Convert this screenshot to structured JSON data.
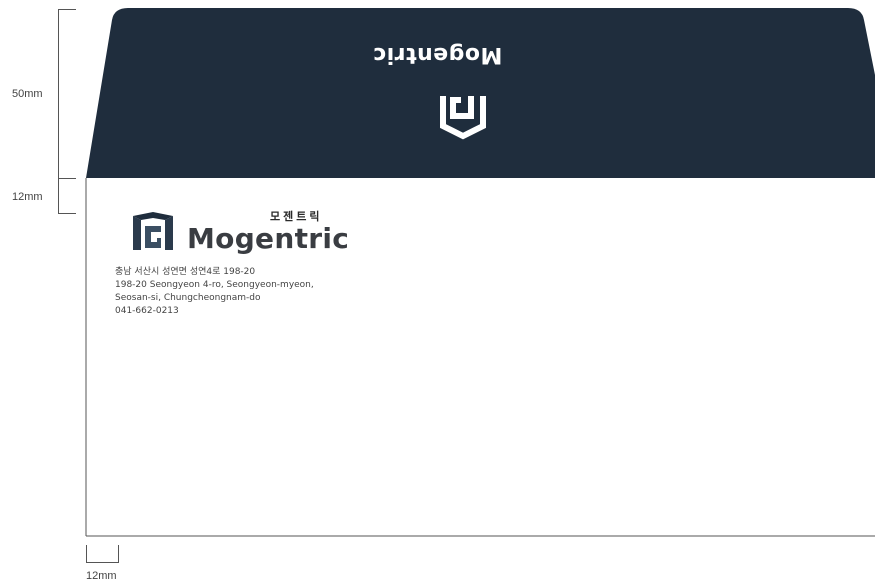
{
  "dimensions": {
    "flap_height": "50mm",
    "top_margin": "12mm",
    "left_margin": "12mm"
  },
  "flap": {
    "brand_text": "Mogentric",
    "color": "#1f2d3d"
  },
  "front": {
    "korean_name": "모젠트릭",
    "brand_name": "Mogentric",
    "address_lines": [
      "충남 서산시 성연면 성연4로 198-20",
      "198-20 Seongyeon 4-ro, Seongyeon-myeon,",
      "Seosan-si, Chungcheongnam-do",
      "041-662-0213"
    ]
  },
  "colors": {
    "navy": "#1f2d3d",
    "logo_dark": "#2a3a4c",
    "text": "#3a3d42"
  }
}
